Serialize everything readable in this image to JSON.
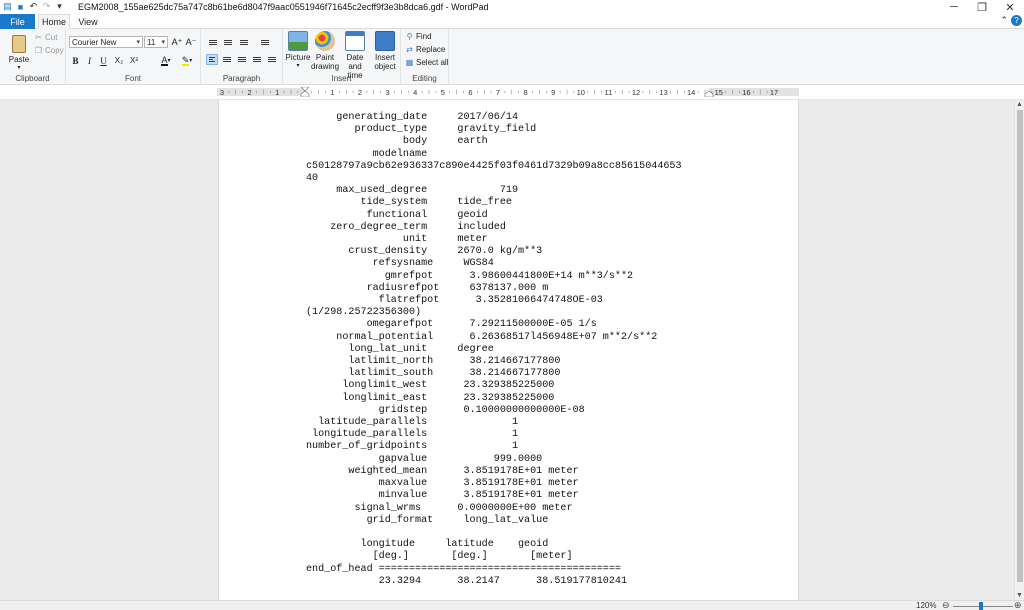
{
  "window": {
    "title": "EGM2008_155ae625dc75a747c8b61be6d8047f9aac0551946f71645c2ecff9f3e3b8dca6.gdf - WordPad"
  },
  "tabs": {
    "file": "File",
    "home": "Home",
    "view": "View"
  },
  "ribbon": {
    "clipboard": {
      "label": "Clipboard",
      "paste": "Paste",
      "cut": "Cut",
      "copy": "Copy"
    },
    "font": {
      "label": "Font",
      "family": "Courier New",
      "size": "11",
      "bold": "B",
      "italic": "I",
      "underline": "U",
      "subscript": "X₂",
      "superscript": "X²"
    },
    "paragraph": {
      "label": "Paragraph"
    },
    "insert": {
      "label": "Insert",
      "picture": "Picture",
      "paint_line1": "Paint",
      "paint_line2": "drawing",
      "date_line1": "Date and",
      "date_line2": "time",
      "object_line1": "Insert",
      "object_line2": "object"
    },
    "editing": {
      "label": "Editing",
      "find": "Find",
      "replace": "Replace",
      "select_all": "Select all"
    }
  },
  "ruler": {
    "numbers": [
      "3",
      "2",
      "1",
      "1",
      "2",
      "3",
      "4",
      "5",
      "6",
      "7",
      "8",
      "9",
      "10",
      "11",
      "12",
      "13",
      "14",
      "15",
      "16",
      "17"
    ]
  },
  "document": {
    "lines": [
      "     generating_date     2017/06/14",
      "        product_type     gravity_field",
      "                body     earth",
      "           modelname",
      "c50128797a9cb62e936337c890e4425f03f0461d7329b09a8cc85615044653",
      "40",
      "     max_used_degree            719",
      "         tide_system     tide_free",
      "          functional     geoid",
      "    zero_degree_term     included",
      "                unit     meter",
      "       crust_density     2670.0 kg/m**3",
      "           refsysname     WGS84",
      "             gmrefpot      3.98600441800E+14 m**3/s**2",
      "          radiusrefpot     6378137.000 m",
      "            flatrefpot      3.35281066474748OE-03",
      "(1/298.25722356300)",
      "          omegarefpot      7.29211500000E-05 1/s",
      "     normal_potential      6.26368517l456948E+07 m**2/s**2",
      "       long_lat_unit     degree",
      "       latlimit_north      38.214667177800",
      "       latlimit_south      38.214667177800",
      "      longlimit_west      23.329385225000",
      "      longlimit_east      23.329385225000",
      "            gridstep      0.10000000000000E-08",
      "  latitude_parallels              1",
      " longitude_parallels              1",
      "number_of_gridpoints              1",
      "            gapvalue           999.0000",
      "       weighted_mean      3.8519178E+01 meter",
      "            maxvalue      3.8519178E+01 meter",
      "            minvalue      3.8519178E+01 meter",
      "        signal_wrms      0.0000000E+00 meter",
      "          grid_format     long_lat_value",
      "",
      "         longitude     latitude    geoid",
      "           [deg.]       [deg.]       [meter]",
      "end_of_head ========================================",
      "            23.3294      38.2147      38.519177810241"
    ]
  },
  "status": {
    "zoom": "120%"
  }
}
